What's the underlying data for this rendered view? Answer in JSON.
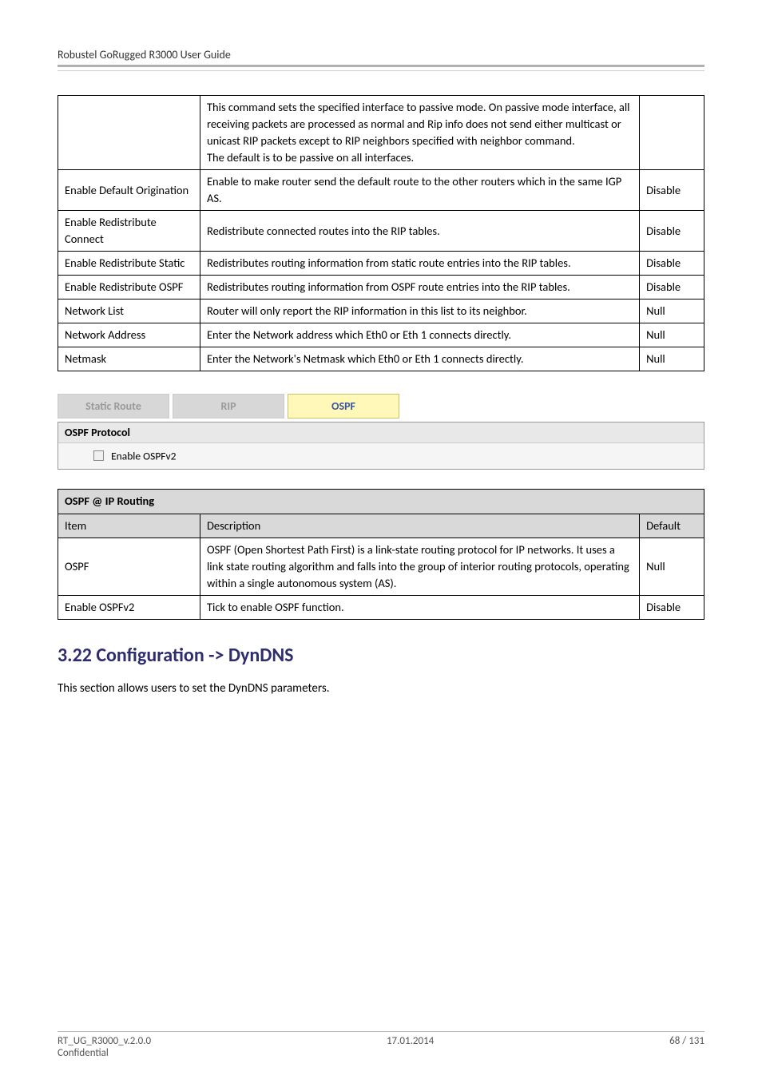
{
  "header": {
    "title": "Robustel GoRugged R3000 User Guide"
  },
  "table1": {
    "rows": [
      {
        "c1": "",
        "c2": "This command sets the specified interface to passive mode. On passive mode interface, all receiving packets are processed as normal and Rip info does not send either multicast or unicast RIP packets except to RIP neighbors specified with neighbor command.\nThe default is to be passive on all interfaces.",
        "c3": ""
      },
      {
        "c1": "Enable Default Origination",
        "c2": "Enable to make router send the default route to the other routers which in the same IGP AS.",
        "c3": "Disable"
      },
      {
        "c1": "Enable Redistribute Connect",
        "c2": "Redistribute connected routes into the RIP tables.",
        "c3": "Disable"
      },
      {
        "c1": "Enable Redistribute Static",
        "c2": "Redistributes routing information from static route entries into the RIP tables.",
        "c3": "Disable"
      },
      {
        "c1": "Enable Redistribute OSPF",
        "c2": "Redistributes routing information from OSPF route entries into the RIP tables.",
        "c3": "Disable"
      },
      {
        "c1": "Network List",
        "c2": "Router will only report the RIP information in this list to its neighbor.",
        "c3": "Null"
      },
      {
        "c1": "Network Address",
        "c2": "Enter the Network address which Eth0 or Eth 1 connects directly.",
        "c3": "Null"
      },
      {
        "c1": "Netmask",
        "c2": "Enter the Network's Netmask which Eth0 or Eth 1 connects directly.",
        "c3": "Null"
      }
    ]
  },
  "tabs": {
    "static_route": "Static Route",
    "rip": "RIP",
    "ospf": "OSPF"
  },
  "panel": {
    "title": "OSPF Protocol",
    "checkbox_label": "Enable OSPFv2"
  },
  "table2": {
    "caption": "OSPF @ IP Routing",
    "header_item": "Item",
    "header_desc": "Description",
    "header_def": "Default",
    "rows": [
      {
        "c1": "OSPF",
        "c2": "OSPF (Open Shortest Path First) is a link-state routing protocol for IP networks. It uses a link state routing algorithm and falls into the group of interior routing protocols, operating within a single autonomous system (AS).",
        "c3": "Null"
      },
      {
        "c1": "Enable OSPFv2",
        "c2": "Tick to enable OSPF function.",
        "c3": "Disable"
      }
    ]
  },
  "section": {
    "number_title": "3.22  Configuration -> DynDNS",
    "intro": "This section allows users to set the DynDNS parameters."
  },
  "footer": {
    "left1": "RT_UG_R3000_v.2.0.0",
    "left2": "Confidential",
    "center": "17.01.2014",
    "right": "68 / 131"
  }
}
